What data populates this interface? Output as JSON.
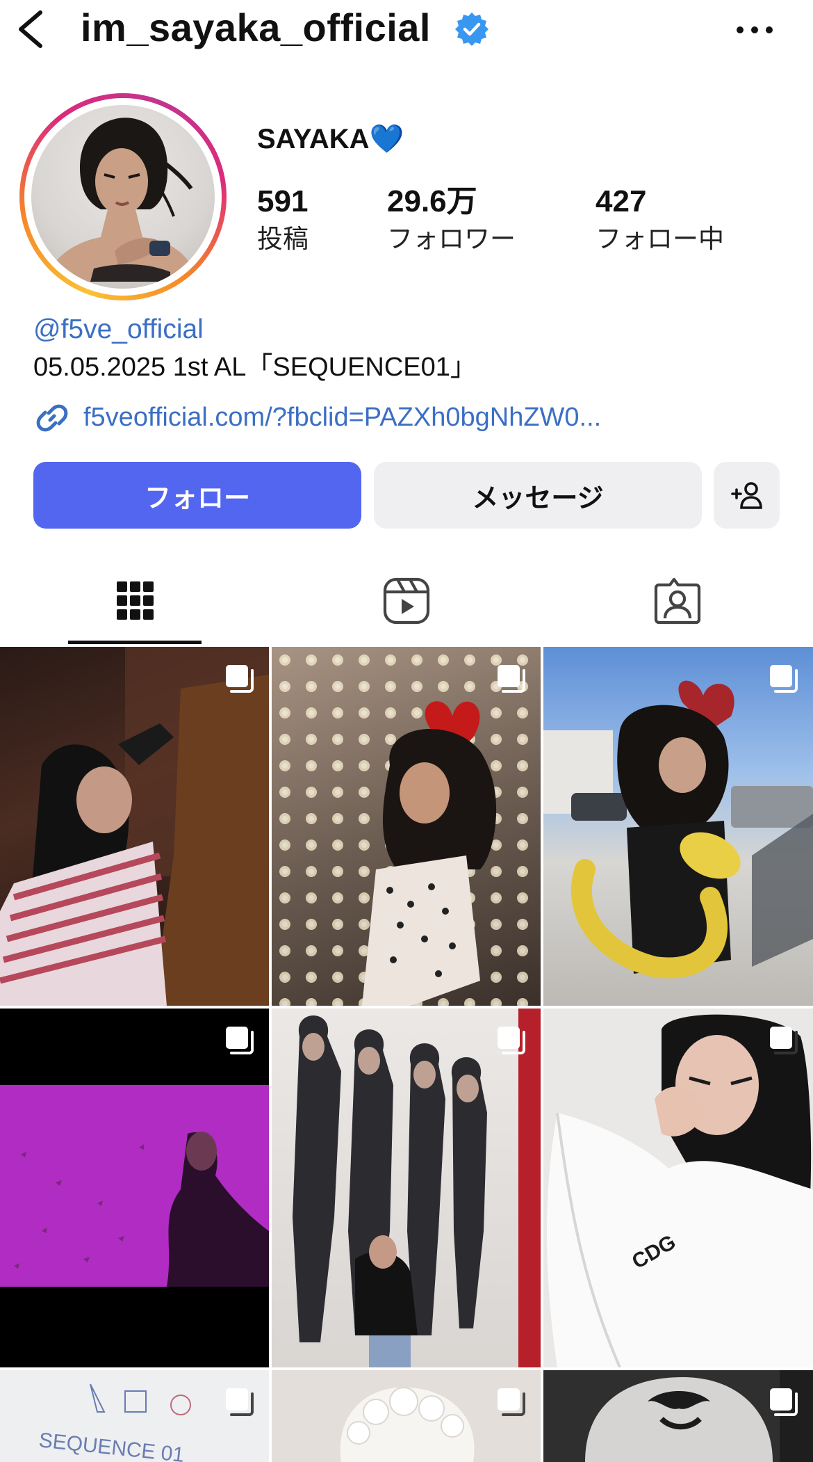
{
  "header": {
    "username": "im_sayaka_official",
    "verified": true,
    "back_icon": "chevron-left-icon",
    "more_icon": "more-horizontal-icon"
  },
  "profile": {
    "display_name": "SAYAKA💙",
    "stats": [
      {
        "value": "591",
        "label": "投稿"
      },
      {
        "value": "29.6万",
        "label": "フォロワー"
      },
      {
        "value": "427",
        "label": "フォロー中"
      }
    ],
    "bio_handle": "@f5ve_official",
    "bio_text": "05.05.2025 1st AL「SEQUENCE01」",
    "link": "f5veofficial.com/?fbclid=PAZXh0bgNhZW0..."
  },
  "actions": {
    "follow_label": "フォロー",
    "message_label": "メッセージ",
    "suggest_icon": "add-person-icon"
  },
  "tabs": [
    {
      "name": "posts",
      "icon": "grid-icon",
      "active": true
    },
    {
      "name": "reels",
      "icon": "reels-icon",
      "active": false
    },
    {
      "name": "tagged",
      "icon": "tagged-person-icon",
      "active": false
    }
  ],
  "posts": [
    {
      "id": "post-1",
      "multi": true
    },
    {
      "id": "post-2",
      "multi": true
    },
    {
      "id": "post-3",
      "multi": true
    },
    {
      "id": "post-4",
      "multi": true
    },
    {
      "id": "post-5",
      "multi": true
    },
    {
      "id": "post-6",
      "multi": true
    },
    {
      "id": "post-7",
      "multi": true
    },
    {
      "id": "post-8",
      "multi": true
    },
    {
      "id": "post-9",
      "multi": true
    }
  ],
  "colors": {
    "link": "#3b6fc4",
    "follow_button": "#5366f0",
    "secondary_button": "#efeff1",
    "verified_badge": "#3897f0"
  }
}
